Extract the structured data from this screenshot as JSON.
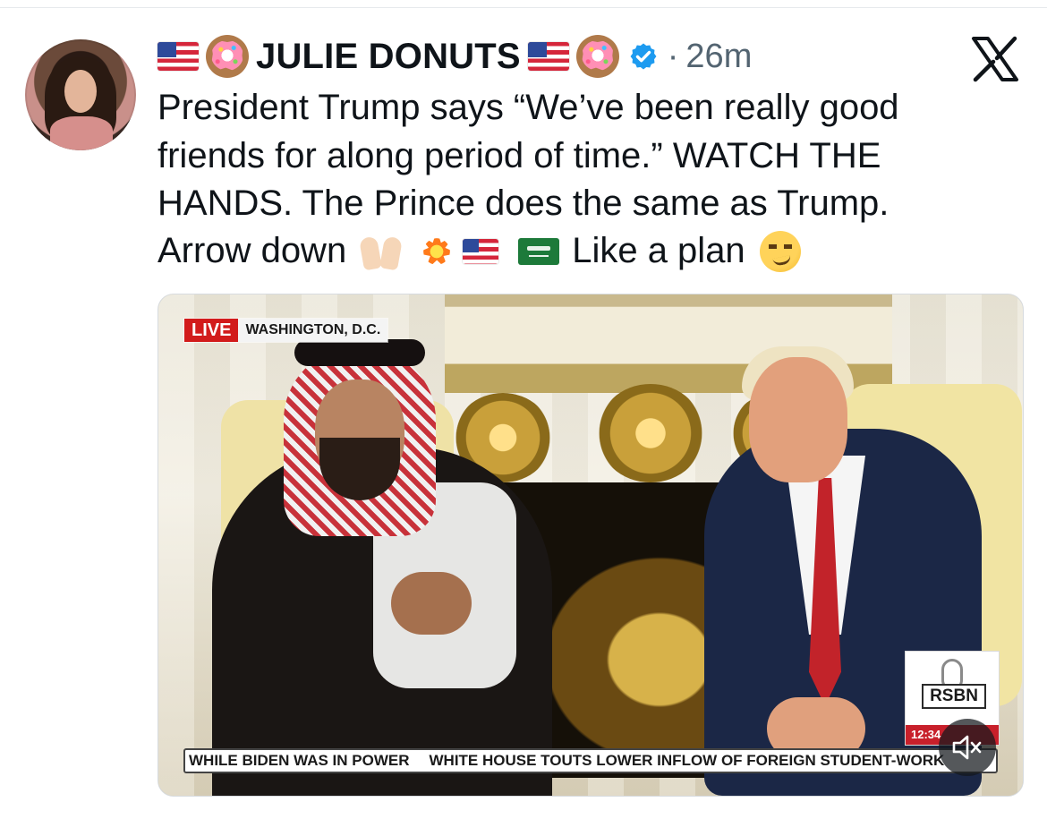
{
  "author": {
    "display_name": "JULIE DONUTS",
    "timestamp": "26m",
    "separator": "·"
  },
  "icons": {
    "flag_us": "flag-us-icon",
    "donut": "donut-icon",
    "verified": "verified-badge-icon",
    "x_logo": "x-logo-icon",
    "raised_hands": "raised-hands-icon",
    "collision": "collision-icon",
    "flag_sa": "flag-saudi-icon",
    "smirk": "smirking-face-icon",
    "mute": "muted-speaker-icon"
  },
  "colors": {
    "verified": "#1d9bf0",
    "text": "#0f1419",
    "muted_text": "#536471",
    "live_red": "#d21b1b"
  },
  "tweet": {
    "text_lines": "President Trump says “We’ve been really good\nfriends for along period of time.” WATCH THE\nHANDS. The Prince does the same as Trump.",
    "line4_start": "Arrow down",
    "line4_end": "Like a plan"
  },
  "video": {
    "live_label": "LIVE",
    "location": "WASHINGTON, D.C.",
    "network": "RSBN",
    "clock": "12:34",
    "ticker_left": "WHILE BIDEN WAS IN POWER",
    "ticker_right": "WHITE HOUSE TOUTS LOWER INFLOW OF FOREIGN STUDENT-WORK"
  }
}
